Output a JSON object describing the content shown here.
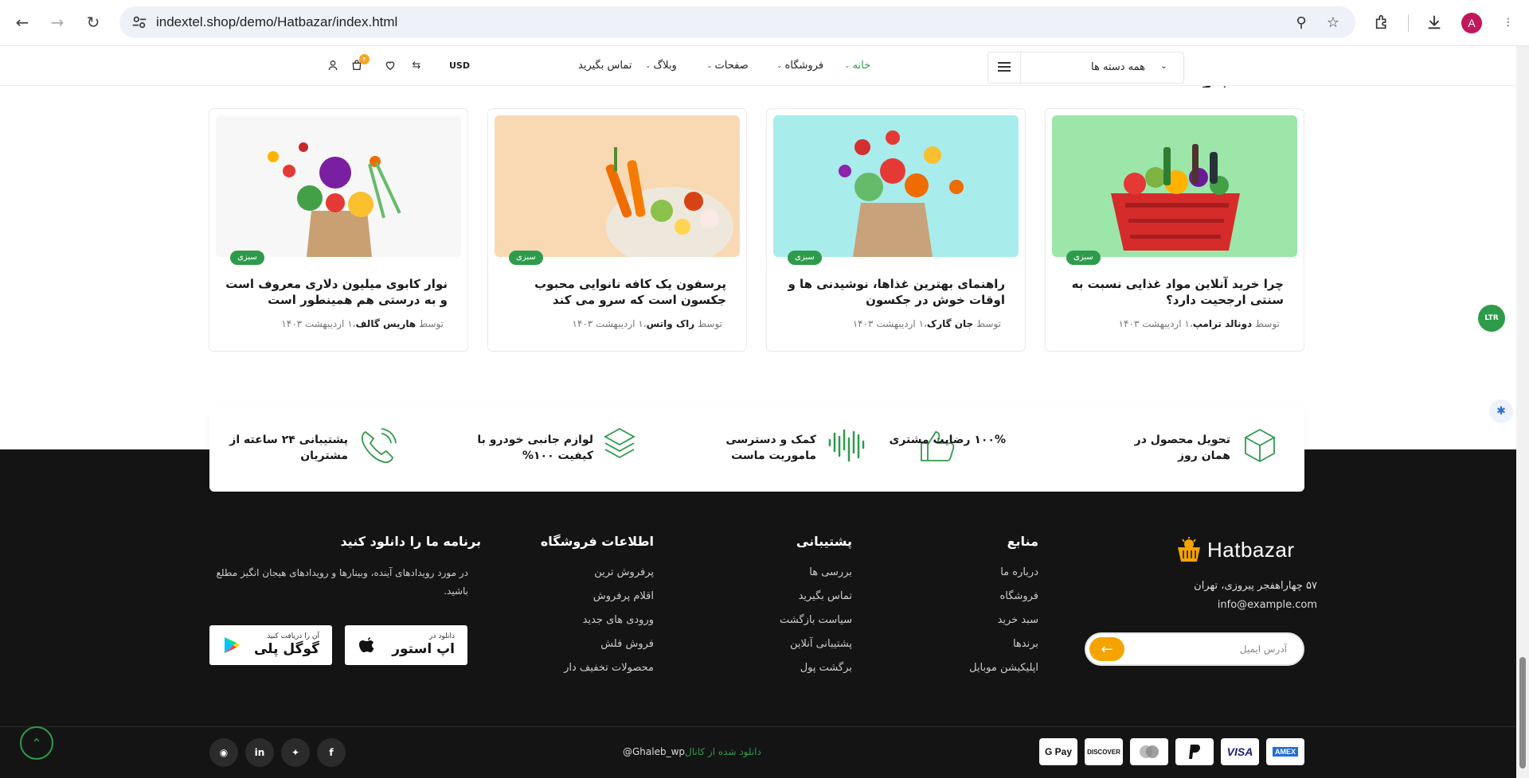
{
  "browser": {
    "url": "indextel.shop/demo/Hatbazar/index.html",
    "profile_initial": "A"
  },
  "header": {
    "categories_label": "همه دسته ها",
    "menu": [
      {
        "label": "خانه",
        "active": true
      },
      {
        "label": "فروشگاه"
      },
      {
        "label": "صفحات"
      },
      {
        "label": "وبلاگ"
      },
      {
        "label": "تماس بگیرید"
      }
    ],
    "currency": "USD",
    "cart_count": "۴"
  },
  "blog": {
    "section_title_partial": "آخرین اخبار",
    "posts": [
      {
        "tag": "سبزی",
        "title": "چرا خرید آنلاین مواد غذایی نسبت به سنتی ارجحیت دارد؟",
        "by": "توسط",
        "author": "دونالد ترامپ",
        "date": "۱ اردیبهشت ۱۴۰۳"
      },
      {
        "tag": "سبزی",
        "title": "راهنمای بهترین غذاها، نوشیدنی ها و اوقات خوش در جکسون",
        "by": "توسط",
        "author": "جان گارک",
        "date": "۱ اردیبهشت ۱۴۰۳"
      },
      {
        "tag": "سبزی",
        "title": "پرسفون یک کافه نانوایی محبوب جکسون است که سرو می کند",
        "by": "توسط",
        "author": "راک واتس",
        "date": "۱ اردیبهشت ۱۴۰۳"
      },
      {
        "tag": "سبزی",
        "title": "نوار کابوی میلیون دلاری معروف است و به درستی هم همینطور است",
        "by": "توسط",
        "author": "هاریس گالف",
        "date": "۱ اردیبهشت ۱۴۰۳"
      }
    ]
  },
  "features": [
    {
      "icon": "box-icon",
      "title": "تحویل محصول در همان روز"
    },
    {
      "icon": "thumbs-up-icon",
      "title": "۱۰۰% رضایت مشتری"
    },
    {
      "icon": "support-wave-icon",
      "title": "کمک و دسترسی ماموریت ماست"
    },
    {
      "icon": "layers-icon",
      "title": "لوازم جانبی خودرو با کیفیت ۱۰۰%"
    },
    {
      "icon": "phone-icon",
      "title": "پشتیبانی ۲۴ ساعته از مشتریان"
    }
  ],
  "footer": {
    "brand": "Hatbazar",
    "address": "۵۷ چهاراهفجر پیروزی، تهران",
    "email": "info@example.com",
    "subscribe_placeholder": "آدرس ایمیل",
    "columns": [
      {
        "title": "منابع",
        "links": [
          "درباره ما",
          "فروشگاه",
          "سبد خرید",
          "برندها",
          "اپلیکیشن موبایل"
        ]
      },
      {
        "title": "پشتیبانی",
        "links": [
          "بررسی ها",
          "تماس بگیرید",
          "سیاست بازگشت",
          "پشتیبانی آنلاین",
          "برگشت پول"
        ]
      },
      {
        "title": "اطلاعات فروشگاه",
        "links": [
          "پرفروش ترین",
          "اقلام پرفروش",
          "ورودی های جدید",
          "فروش فلش",
          "محصولات تخفیف دار"
        ]
      }
    ],
    "app": {
      "title": "برنامه ما را دانلود کنید",
      "desc": "در مورد رویدادهای آینده، وبینارها و رویدادهای هیجان انگیز مطلع باشید.",
      "appstore_small": "دانلود در",
      "appstore_big": "اپ استور",
      "googleplay_small": "آن را دریافت کنید",
      "googleplay_big": "گوگل پلی"
    },
    "credit_prefix": "دانلود شده از کانال",
    "credit_handle": "@Ghaleb_wp",
    "payments": [
      "AMEX",
      "VISA",
      "PayPal",
      "Mastercard",
      "DISCOVER",
      "G Pay"
    ]
  },
  "ltr_label": "LTR",
  "colors": {
    "brand_green": "#2e9b4b",
    "accent_orange": "#f5a300",
    "footer_bg": "#141414"
  }
}
